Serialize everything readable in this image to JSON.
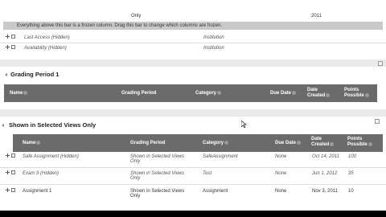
{
  "top_rows": [
    {
      "left": "",
      "mid": "Only",
      "right": "2011"
    }
  ],
  "frozen_note": "Everything above this bar is a frozen column. Drag this bar to change which columns are frozen.",
  "hidden_rows": [
    {
      "name": "Last Access (Hidden)",
      "category": "Institution"
    },
    {
      "name": "Availability (Hidden)",
      "category": "Institution"
    }
  ],
  "grading_period_section": {
    "title": "Grading Period 1",
    "columns": [
      "Name",
      "Grading Period",
      "Category",
      "Due Date",
      "Date Created",
      "Points Possible"
    ]
  },
  "selected_views_section": {
    "title": "Shown in Selected Views Only",
    "columns": [
      "Name",
      "Grading Period",
      "Category",
      "Due Date",
      "Date Created",
      "Points Possible"
    ],
    "rows": [
      {
        "name": "Safe Assignment (Hidden)",
        "period": "Shown in Selected Views Only",
        "category": "SafeAssignment",
        "due": "None",
        "created": "Oct 14, 2011",
        "points": "100",
        "hidden": true
      },
      {
        "name": "Exam 9 (Hidden)",
        "period": "Shown in Selected Views Only",
        "category": "Test",
        "due": "None",
        "created": "Jun 1, 2012",
        "points": "35",
        "hidden": true
      },
      {
        "name": "Assignment 1",
        "period": "Shown in Selected Views Only",
        "category": "Assignment",
        "due": "None",
        "created": "Nov 3, 2011",
        "points": "10",
        "hidden": false
      }
    ]
  }
}
